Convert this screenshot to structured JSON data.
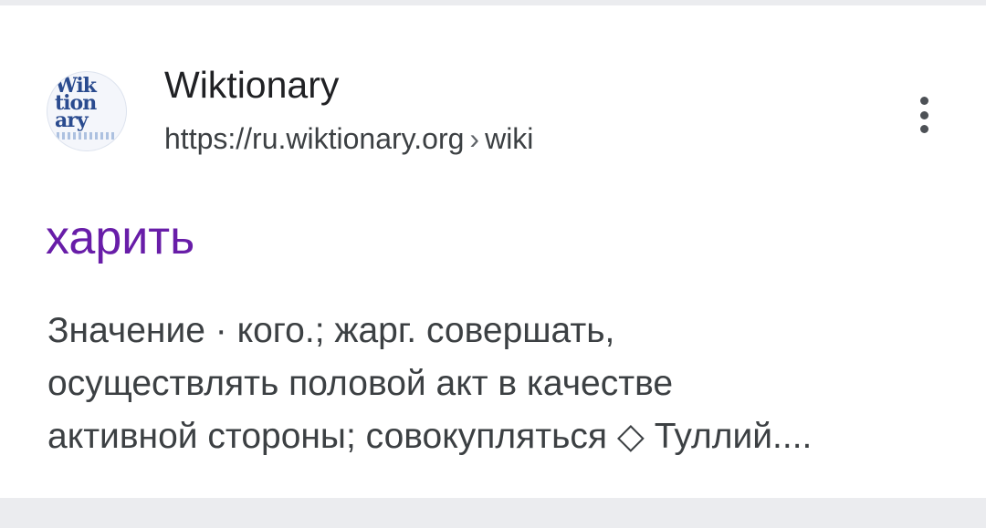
{
  "result": {
    "site_name": "Wiktionary",
    "favicon": {
      "icon": "wiktionary-logo",
      "letters": "Wik\ntion\nary"
    },
    "breadcrumb": {
      "url": "https://ru.wiktionary.org",
      "separator": "›",
      "path": "wiki"
    },
    "menu_icon": "more-vert-icon",
    "title": "харить",
    "snippet_lines": [
      "Значение · кого.; жарг. совершать,",
      "осуществлять половой акт в качестве",
      "активной стороны; совокупляться ◇ Туллий...."
    ]
  },
  "colors": {
    "page_background": "#ebecef",
    "card_background": "#ffffff",
    "title_visited": "#681da8",
    "text_primary": "#202124",
    "text_secondary": "#3c4043"
  }
}
